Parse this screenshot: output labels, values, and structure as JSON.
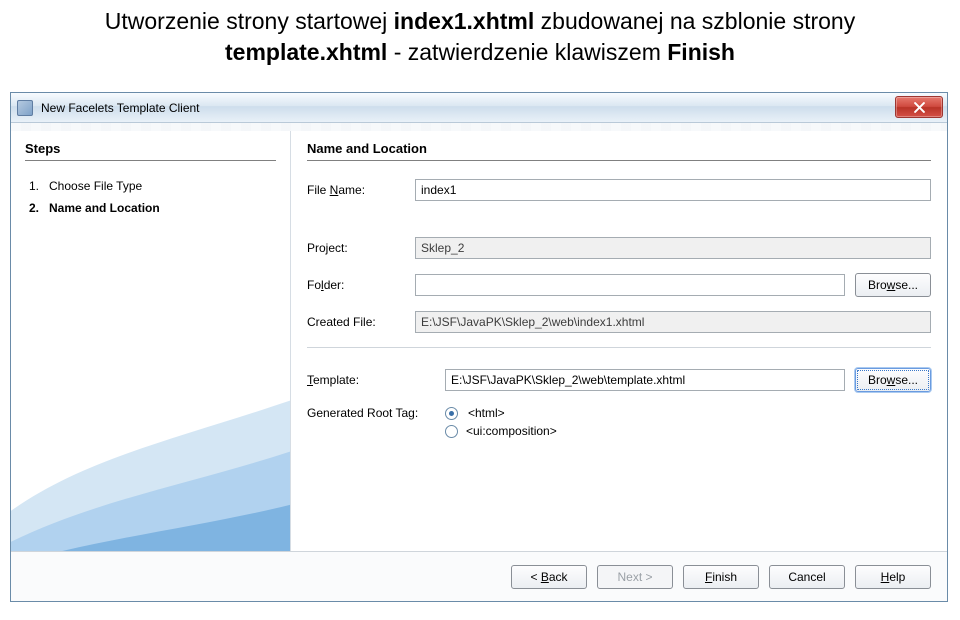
{
  "caption": {
    "pre": "Utworzenie strony startowej ",
    "file1": "index1.xhtml",
    "mid": " zbudowanej na szblonie strony ",
    "file2": "template.xhtml",
    "post": " - zatwierdzenie klawiszem ",
    "action": "Finish"
  },
  "dialog": {
    "title": "New Facelets Template Client",
    "steps": {
      "header": "Steps",
      "items": [
        {
          "num": "1.",
          "label": "Choose File Type",
          "current": false
        },
        {
          "num": "2.",
          "label": "Name and Location",
          "current": true
        }
      ]
    },
    "section_title": "Name and Location",
    "fields": {
      "file_name_label": "File Name:",
      "file_name_value": "index1",
      "project_label": "Project:",
      "project_value": "Sklep_2",
      "folder_label": "Folder:",
      "folder_value": "",
      "created_file_label": "Created File:",
      "created_file_value": "E:\\JSF\\JavaPK\\Sklep_2\\web\\index1.xhtml",
      "template_label": "Template:",
      "template_value": "E:\\JSF\\JavaPK\\Sklep_2\\web\\template.xhtml",
      "root_tag_label": "Generated Root Tag:",
      "root_option_html": "<html>",
      "root_option_composition": "<ui:composition>"
    },
    "buttons": {
      "browse": "Browse...",
      "back": "< Back",
      "next": "Next >",
      "finish": "Finish",
      "cancel": "Cancel",
      "help": "Help"
    }
  }
}
